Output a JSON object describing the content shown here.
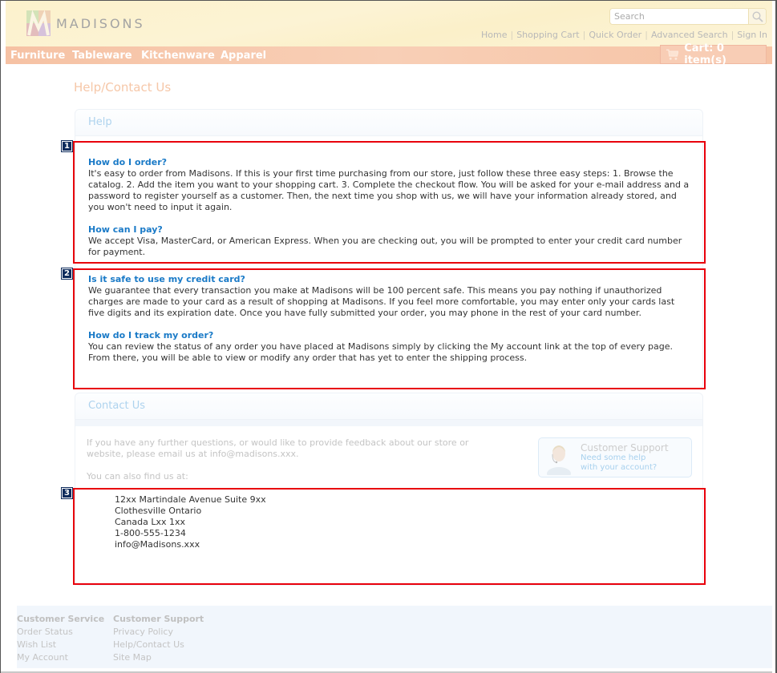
{
  "header": {
    "logo_text": "MADISONS",
    "search": {
      "placeholder": "Search",
      "value": ""
    },
    "util_links": [
      "Home",
      "Shopping Cart",
      "Quick Order",
      "Advanced Search",
      "Sign In"
    ]
  },
  "nav": {
    "items": [
      "Furniture",
      "Tableware",
      "Kitchenware",
      "Apparel"
    ],
    "cart_label": "Cart: 0 item(s)"
  },
  "page_title": "Help/Contact Us",
  "help": {
    "title": "Help",
    "faqs": [
      {
        "question": "How do I order?",
        "answer": "It's easy to order from Madisons. If this is your first time purchasing from our store, just follow these three easy steps: 1. Browse the catalog. 2. Add the item you want to your shopping cart. 3. Complete the checkout flow. You will be asked for your e-mail address and a password to register yourself as a customer. Then, the next time you shop with us, we will have your information already stored, and you won't need to input it again."
      },
      {
        "question": "How can I pay?",
        "answer": "We accept Visa, MasterCard, or American Express. When you are checking out, you will be prompted to enter your credit card number for payment."
      },
      {
        "question": "Is it safe to use my credit card?",
        "answer": "We guarantee that every transaction you make at Madisons will be 100 percent safe. This means you pay nothing if unauthorized charges are made to your card as a result of shopping at Madisons. If you feel more comfortable, you may enter only your cards last five digits and its expiration date. Once you have fully submitted your order, you may phone in the rest of your card number."
      },
      {
        "question": "How do I track my order?",
        "answer": "You can review the status of any order you have placed at Madisons simply by clicking the My account link at the top of every page. From there, you will be able to view or modify any order that has yet to enter the shipping process."
      }
    ]
  },
  "contact": {
    "title": "Contact Us",
    "intro": "If you have any further questions, or would like to provide feedback about our store or website, please email us at info@madisons.xxx.",
    "find_us": "You can also find us at:",
    "address_lines": [
      "12xx Martindale Avenue Suite 9xx",
      "Clothesville Ontario",
      "Canada Lxx 1xx",
      "1-800-555-1234",
      "info@Madisons.xxx"
    ],
    "support_card": {
      "title": "Customer Support",
      "link_line1": "Need some help",
      "link_line2": "with your account?"
    }
  },
  "annotations": [
    "1",
    "2",
    "3"
  ],
  "footer": {
    "columns": [
      {
        "heading": "Customer Service",
        "links": [
          "Order Status",
          "Wish List",
          "My Account"
        ]
      },
      {
        "heading": "Customer Support",
        "links": [
          "Privacy Policy",
          "Help/Contact Us",
          "Site Map"
        ]
      }
    ]
  },
  "colors": {
    "nav_bg": "#f6c2a4",
    "header_bg": "#fcf2cc",
    "question": "#1a7ac7",
    "annotation_border": "#e8000b",
    "annotation_badge": "#0d2b5c",
    "footer_bg": "#f1f6fc"
  }
}
